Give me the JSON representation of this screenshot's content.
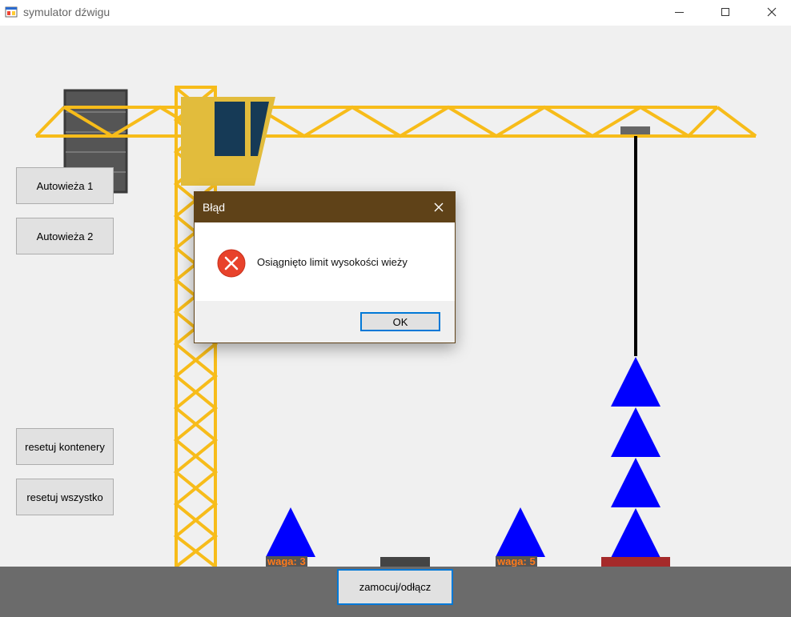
{
  "window": {
    "title": "symulator dźwigu",
    "icon": "app-window-icon"
  },
  "sidebar": {
    "autotower1": "Autowieża 1",
    "autotower2": "Autowieża 2",
    "reset_containers": "resetuj kontenery",
    "reset_all": "resetuj wszystko"
  },
  "bottom": {
    "attach_detach": "zamocuj/odłącz"
  },
  "containers": [
    {
      "weight_label": "waga: 3"
    },
    {
      "weight_label": "waga: 5"
    }
  ],
  "dialog": {
    "title": "Błąd",
    "message": "Osiągnięto limit wysokości wieży",
    "ok_label": "OK",
    "icon": "error-icon"
  },
  "colors": {
    "crane_yellow": "#f7bc1a",
    "cabin_yellow": "#e2bc3c",
    "cabin_glass": "#163a56",
    "container_blue": "#0000ff",
    "ground_gray": "#6b6b6b",
    "pad_red": "#a52a2a",
    "dialog_titlebar": "#5f4218",
    "accent_blue": "#0078d7",
    "weight_label_orange": "#ff7a1a"
  }
}
